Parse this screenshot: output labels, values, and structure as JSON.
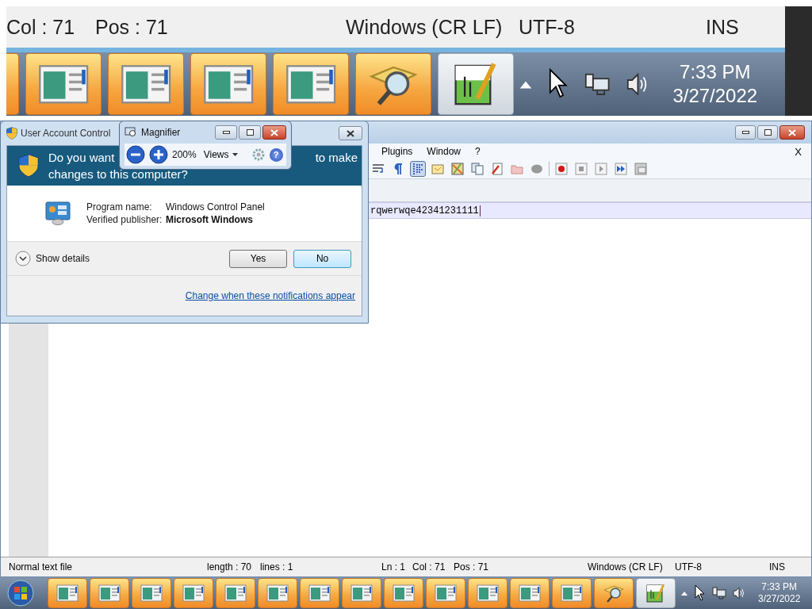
{
  "magnified_view": {
    "status_bar": [
      "Col : 71",
      "Pos : 71",
      "Windows (CR LF)",
      "UTF-8",
      "INS"
    ],
    "taskbar_buttons": [
      {
        "kind": "edge",
        "selected": false
      },
      {
        "kind": "window",
        "selected": false
      },
      {
        "kind": "window",
        "selected": false
      },
      {
        "kind": "window",
        "selected": false
      },
      {
        "kind": "window",
        "selected": false
      },
      {
        "kind": "magnifier",
        "selected": false
      },
      {
        "kind": "notepad",
        "selected": true
      }
    ],
    "clock": {
      "time": "7:33 PM",
      "date": "3/27/2022"
    }
  },
  "editor_window": {
    "menu": [
      "Plugins",
      "Window",
      "?"
    ],
    "close_tab": "X",
    "toolbar": [
      {
        "kind": "wrap"
      },
      {
        "kind": "pilcrow"
      },
      {
        "kind": "indent",
        "pressed": true
      },
      {
        "kind": "note"
      },
      {
        "kind": "map"
      },
      {
        "kind": "copy"
      },
      {
        "kind": "pen"
      },
      {
        "kind": "folder"
      },
      {
        "kind": "blob"
      },
      {
        "kind": "sep"
      },
      {
        "kind": "record"
      },
      {
        "kind": "stop"
      },
      {
        "kind": "play"
      },
      {
        "kind": "ffwd"
      },
      {
        "kind": "panel"
      }
    ],
    "text_line": "rqwerwqe42341231111",
    "status_bar": [
      "Normal text file",
      "length : 70",
      "lines : 1",
      "Ln : 1",
      "Col : 71",
      "Pos : 71",
      "Windows (CR LF)",
      "UTF-8",
      "INS"
    ]
  },
  "uac_dialog": {
    "title": "User Account Control",
    "heading_start": "Do you want",
    "heading_end": "to make",
    "heading_line2": "changes to this computer?",
    "fields": [
      {
        "label": "Program name:",
        "value": "Windows Control Panel",
        "bold": false
      },
      {
        "label": "Verified publisher:",
        "value": "Microsoft Windows",
        "bold": true
      }
    ],
    "details": "Show details",
    "buttons": [
      {
        "label": "Yes",
        "default": false
      },
      {
        "label": "No",
        "default": true
      }
    ],
    "link": "Change when these notifications appear"
  },
  "magnifier": {
    "title": "Magnifier",
    "zoom": "200%",
    "views": "Views",
    "help": "?"
  },
  "taskbar": {
    "buttons": [
      {
        "kind": "window",
        "selected": false
      },
      {
        "kind": "window",
        "selected": false
      },
      {
        "kind": "window",
        "selected": false
      },
      {
        "kind": "window",
        "selected": false
      },
      {
        "kind": "window",
        "selected": false
      },
      {
        "kind": "window",
        "selected": false
      },
      {
        "kind": "window",
        "selected": false
      },
      {
        "kind": "window",
        "selected": false
      },
      {
        "kind": "window",
        "selected": false
      },
      {
        "kind": "window",
        "selected": false
      },
      {
        "kind": "window",
        "selected": false
      },
      {
        "kind": "window",
        "selected": false
      },
      {
        "kind": "window",
        "selected": false
      },
      {
        "kind": "magnifier",
        "selected": false
      },
      {
        "kind": "notepad",
        "selected": true
      }
    ],
    "clock": {
      "time": "7:33 PM",
      "date": "3/27/2022"
    }
  }
}
